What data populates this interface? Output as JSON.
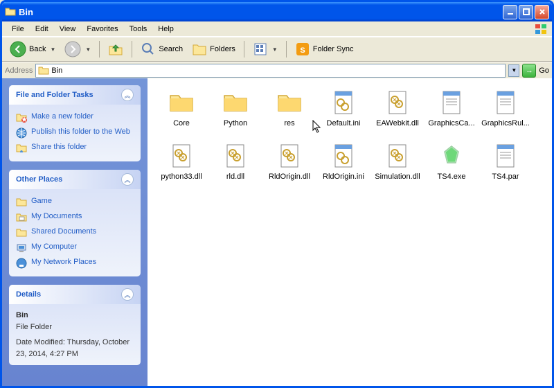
{
  "window": {
    "title": "Bin"
  },
  "menu": [
    "File",
    "Edit",
    "View",
    "Favorites",
    "Tools",
    "Help"
  ],
  "toolbar": {
    "back": "Back",
    "search": "Search",
    "folders": "Folders",
    "foldersync": "Folder Sync"
  },
  "address": {
    "label": "Address",
    "value": "Bin",
    "go": "Go"
  },
  "sidebar": {
    "tasks": {
      "title": "File and Folder Tasks",
      "items": [
        "Make a new folder",
        "Publish this folder to the Web",
        "Share this folder"
      ]
    },
    "places": {
      "title": "Other Places",
      "items": [
        "Game",
        "My Documents",
        "Shared Documents",
        "My Computer",
        "My Network Places"
      ]
    },
    "details": {
      "title": "Details",
      "name": "Bin",
      "type": "File Folder",
      "modified_label": "Date Modified: Thursday, October 23, 2014, 4:27 PM"
    }
  },
  "files": [
    {
      "name": "Core",
      "kind": "folder"
    },
    {
      "name": "Python",
      "kind": "folder"
    },
    {
      "name": "res",
      "kind": "folder"
    },
    {
      "name": "Default.ini",
      "kind": "ini"
    },
    {
      "name": "EAWebkit.dll",
      "kind": "dll"
    },
    {
      "name": "GraphicsCa...",
      "kind": "file"
    },
    {
      "name": "GraphicsRul...",
      "kind": "file"
    },
    {
      "name": "python33.dll",
      "kind": "dll"
    },
    {
      "name": "rld.dll",
      "kind": "dll"
    },
    {
      "name": "RldOrigin.dll",
      "kind": "dll"
    },
    {
      "name": "RldOrigin.ini",
      "kind": "ini"
    },
    {
      "name": "Simulation.dll",
      "kind": "dll"
    },
    {
      "name": "TS4.exe",
      "kind": "exe"
    },
    {
      "name": "TS4.par",
      "kind": "file"
    }
  ]
}
